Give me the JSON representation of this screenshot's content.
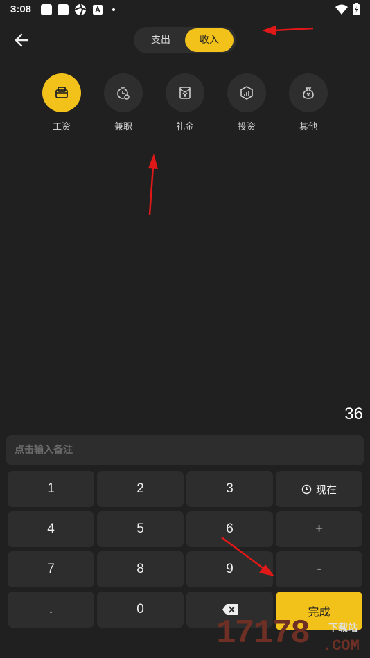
{
  "status_bar": {
    "time": "3:08"
  },
  "tabs": [
    {
      "label": "支出",
      "active": false
    },
    {
      "label": "收入",
      "active": true
    }
  ],
  "categories": [
    {
      "label": "工资",
      "icon": "wallet-icon",
      "active": true
    },
    {
      "label": "兼职",
      "icon": "clock-coin-icon",
      "active": false
    },
    {
      "label": "礼金",
      "icon": "red-envelope-icon",
      "active": false
    },
    {
      "label": "投资",
      "icon": "investment-chart-icon",
      "active": false
    },
    {
      "label": "其他",
      "icon": "money-bag-icon",
      "active": false
    }
  ],
  "amount": "36",
  "note": {
    "placeholder": "点击输入备注",
    "value": ""
  },
  "keypad": {
    "k1": "1",
    "k2": "2",
    "k3": "3",
    "now": "现在",
    "k4": "4",
    "k5": "5",
    "k6": "6",
    "plus": "+",
    "k7": "7",
    "k8": "8",
    "k9": "9",
    "minus": "-",
    "dot": ".",
    "k0": "0",
    "done": "完成"
  },
  "watermark": {
    "number": "17178",
    "site": "下载站",
    "domain": ".COM"
  },
  "colors": {
    "accent": "#f2c21b",
    "background": "#202020",
    "surface": "#2d2d2d"
  }
}
